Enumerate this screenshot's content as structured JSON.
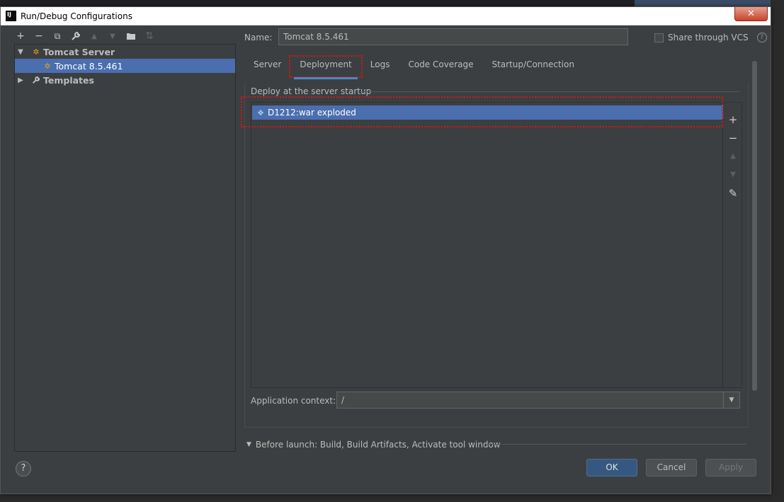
{
  "window": {
    "title": "Run/Debug Configurations",
    "close_glyph": "✕"
  },
  "toolbar": {
    "icons": [
      "add-icon",
      "remove-icon",
      "copy-icon",
      "wrench-icon",
      "move-up-icon",
      "move-down-icon",
      "folder-icon",
      "sort-icon"
    ],
    "glyphs": [
      "+",
      "−",
      "⧉",
      "🔧",
      "▲",
      "▼",
      "📁",
      "⇅"
    ]
  },
  "tree": {
    "items": [
      {
        "label": "Tomcat Server",
        "level": 0,
        "expanded": true,
        "selected": false
      },
      {
        "label": "Tomcat 8.5.461",
        "level": 1,
        "selected": true
      },
      {
        "label": "Templates",
        "level": 0,
        "expanded": false,
        "selected": false
      }
    ]
  },
  "name_field": {
    "label": "Name:",
    "value": "Tomcat 8.5.461"
  },
  "share": {
    "label": "Share through VCS",
    "checked": false,
    "help": "?"
  },
  "tabs": [
    {
      "label": "Server",
      "active": false
    },
    {
      "label": "Deployment",
      "active": true
    },
    {
      "label": "Logs",
      "active": false
    },
    {
      "label": "Code Coverage",
      "active": false
    },
    {
      "label": "Startup/Connection",
      "active": false
    }
  ],
  "deployment": {
    "section_title": "Deploy at the server startup",
    "artifacts": [
      "D1212:war exploded"
    ],
    "side_buttons": {
      "add": "+",
      "remove": "−",
      "up": "▲",
      "down": "▼",
      "edit": "✎"
    }
  },
  "app_context": {
    "label": "Application context:",
    "value": "/"
  },
  "before_launch": {
    "label": "Before launch: Build, Build Artifacts, Activate tool window"
  },
  "footer": {
    "help": "?",
    "ok": "OK",
    "cancel": "Cancel",
    "apply": "Apply"
  },
  "colors": {
    "accent": "#4b6eaf",
    "highlight": "#d01818",
    "primary_button": "#365880"
  }
}
